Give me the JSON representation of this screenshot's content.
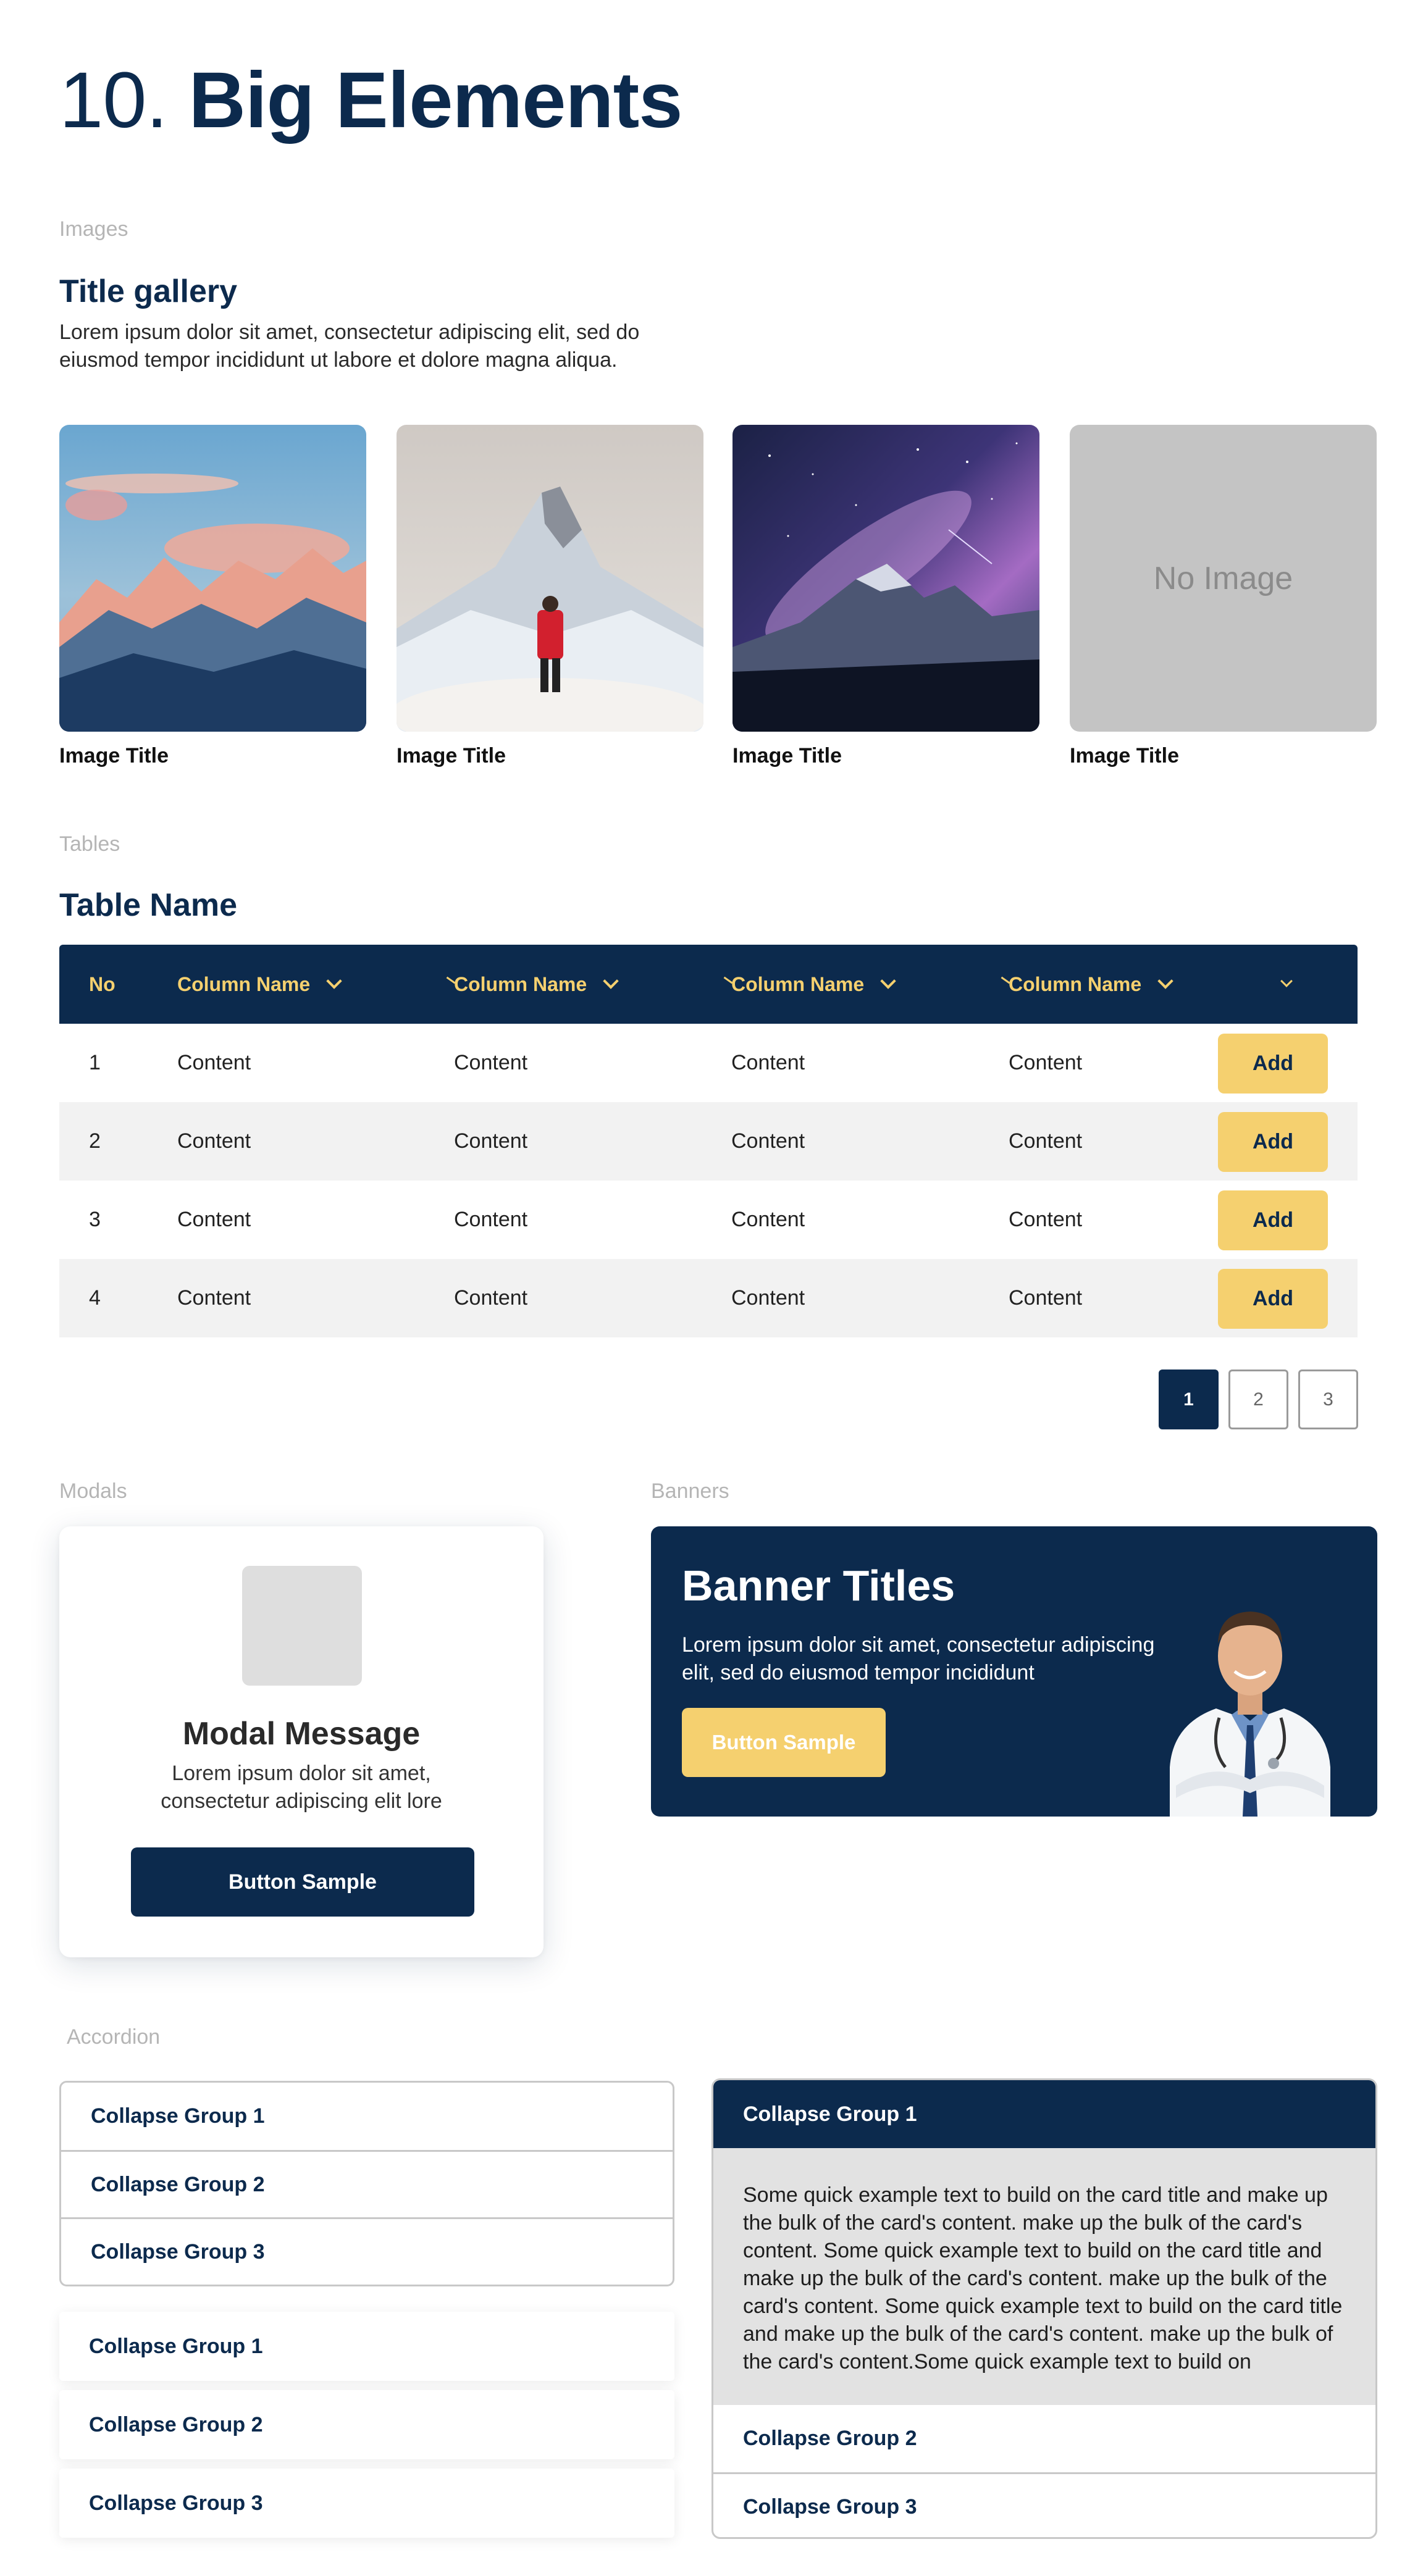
{
  "page": {
    "number": "10.",
    "title": "Big Elements"
  },
  "labels": {
    "images": "Images",
    "tables": "Tables",
    "modals": "Modals",
    "banners": "Banners",
    "accordion": "Accordion"
  },
  "gallery": {
    "title": "Title gallery",
    "description": "Lorem ipsum dolor sit amet, consectetur adipiscing elit, sed do eiusmod tempor incididunt ut labore et dolore magna aliqua.",
    "items": [
      {
        "title": "Image Title",
        "image": "mountain-sunset"
      },
      {
        "title": "Image Title",
        "image": "hiker-matterhorn"
      },
      {
        "title": "Image Title",
        "image": "milky-way-mountain"
      },
      {
        "title": "Image Title",
        "placeholder": "No Image"
      }
    ]
  },
  "table": {
    "title": "Table Name",
    "headers": [
      "No",
      "Column Name",
      "Column Name",
      "Column Name",
      "Column Name"
    ],
    "rows": [
      {
        "no": "1",
        "cells": [
          "Content",
          "Content",
          "Content",
          "Content"
        ],
        "action": "Add"
      },
      {
        "no": "2",
        "cells": [
          "Content",
          "Content",
          "Content",
          "Content"
        ],
        "action": "Add"
      },
      {
        "no": "3",
        "cells": [
          "Content",
          "Content",
          "Content",
          "Content"
        ],
        "action": "Add"
      },
      {
        "no": "4",
        "cells": [
          "Content",
          "Content",
          "Content",
          "Content"
        ],
        "action": "Add"
      }
    ],
    "pagination": [
      "1",
      "2",
      "3"
    ],
    "active_page": "1"
  },
  "modal": {
    "title": "Modal Message",
    "text": "Lorem ipsum dolor sit amet, consectetur adipiscing elit lore",
    "button": "Button Sample"
  },
  "banner": {
    "title": "Banner Titles",
    "text": "Lorem ipsum dolor sit amet, consectetur adipiscing elit, sed do eiusmod tempor incididunt",
    "button": "Button Sample",
    "image": "doctor-portrait"
  },
  "accordion": {
    "bordered": [
      "Collapse Group 1",
      "Collapse Group 2",
      "Collapse Group 3"
    ],
    "shadowed": [
      "Collapse Group 1",
      "Collapse Group 2",
      "Collapse Group 3"
    ],
    "expanded": {
      "open_title": "Collapse Group 1",
      "body": "Some quick example text to build on the card title and make up the bulk of the card's content.  make up the bulk of the card's content. Some quick example text to build on the card title and make up the bulk of the card's content.  make up the bulk of the card's content. Some quick example text to build on the card title and make up the bulk of the card's content.  make up the bulk of the card's content.Some quick example text to build on",
      "others": [
        "Collapse Group 2",
        "Collapse Group 3"
      ]
    }
  },
  "colors": {
    "navy": "#0c2a4d",
    "accent_yellow": "#f5d06f",
    "label_gray": "#b5b5b5",
    "row_alt": "#f2f2f2"
  }
}
